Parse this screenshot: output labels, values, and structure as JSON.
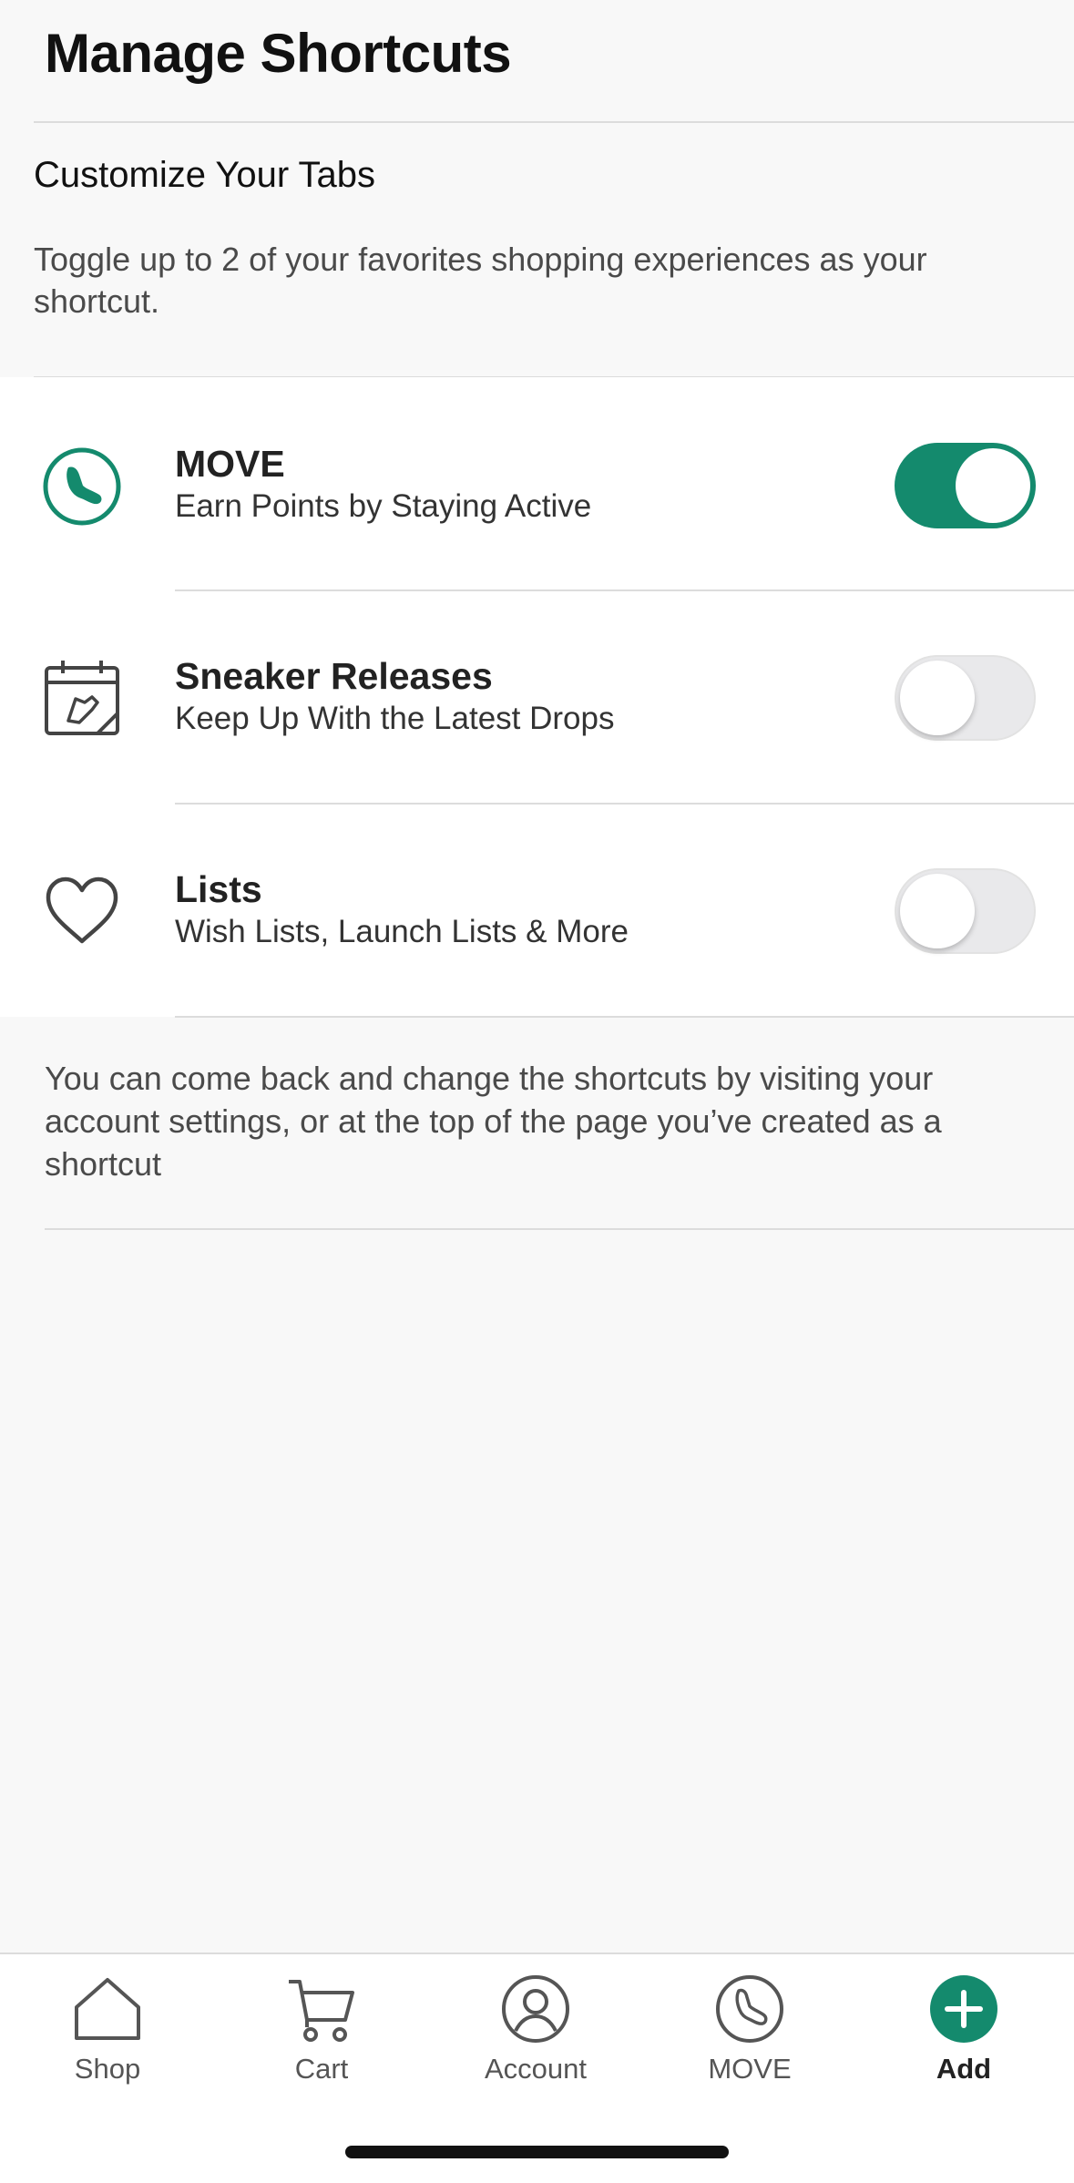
{
  "header": {
    "title": "Manage Shortcuts"
  },
  "section": {
    "heading": "Customize Your Tabs",
    "description": "Toggle up to 2 of your favorites shopping experiences as your shortcut."
  },
  "shortcuts": [
    {
      "icon": "move-shoe-icon",
      "title": "MOVE",
      "subtitle": "Earn Points by Staying Active",
      "enabled": true
    },
    {
      "icon": "calendar-sneaker-icon",
      "title": "Sneaker Releases",
      "subtitle": "Keep Up With the Latest Drops",
      "enabled": false
    },
    {
      "icon": "heart-icon",
      "title": "Lists",
      "subtitle": "Wish Lists, Launch Lists & More",
      "enabled": false
    }
  ],
  "footer_note": "You can come back and change the shortcuts by visiting your account settings, or at the top of the page you’ve created as a shortcut",
  "tabbar": {
    "items": [
      {
        "icon": "home-icon",
        "label": "Shop"
      },
      {
        "icon": "cart-icon",
        "label": "Cart"
      },
      {
        "icon": "account-icon",
        "label": "Account"
      },
      {
        "icon": "move-shoe-icon",
        "label": "MOVE"
      },
      {
        "icon": "add-icon",
        "label": "Add"
      }
    ]
  },
  "colors": {
    "accent": "#148a6d",
    "toggle_off": "#e9e9eb",
    "background": "#f8f8f8"
  }
}
